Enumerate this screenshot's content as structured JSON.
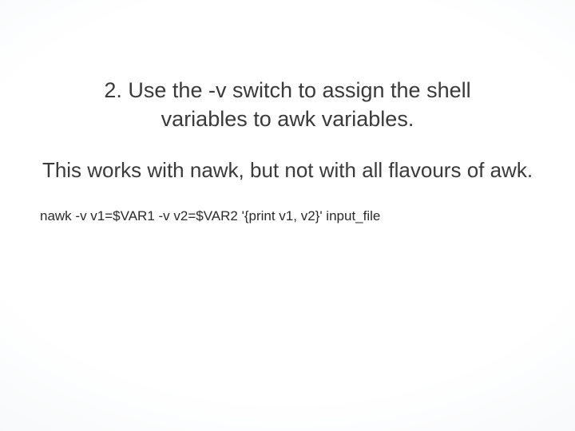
{
  "slide": {
    "heading": "2. Use the -v switch to assign the shell variables to awk variables.",
    "subtext": "This works with nawk, but not with all flavours of awk.",
    "code": "nawk -v v1=$VAR1 -v v2=$VAR2 '{print v1, v2}' input_file"
  }
}
